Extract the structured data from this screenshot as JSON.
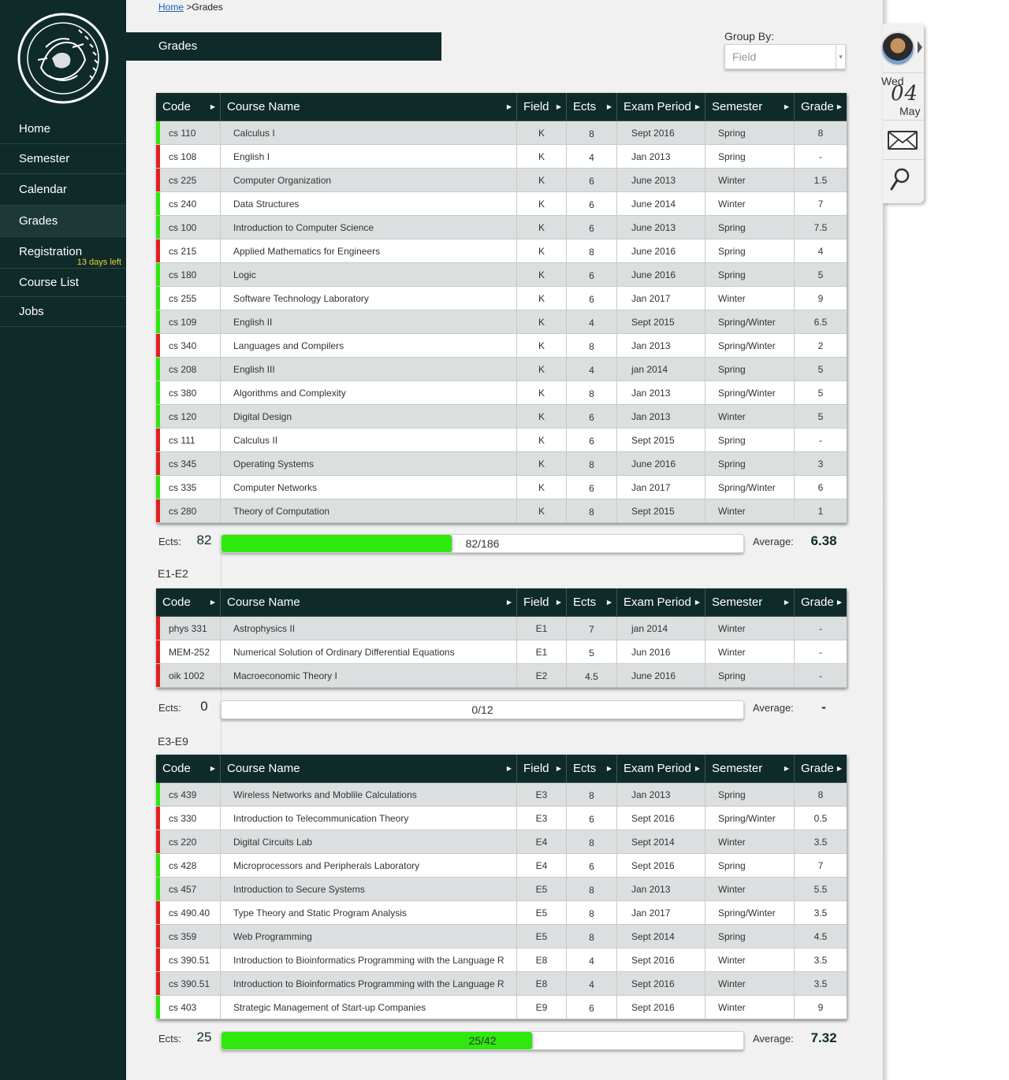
{
  "sidebar": {
    "items": [
      {
        "label": "Home",
        "badge": ""
      },
      {
        "label": "Semester",
        "badge": ""
      },
      {
        "label": "Calendar",
        "badge": ""
      },
      {
        "label": "Grades",
        "badge": ""
      },
      {
        "label": "Registration",
        "badge": "13 days left"
      },
      {
        "label": "Course List",
        "badge": ""
      },
      {
        "label": "Jobs",
        "badge": ""
      }
    ],
    "logo_text": "ΕΥΡΩΠΗ"
  },
  "breadcrumb": {
    "home": "Home",
    "separator": " >",
    "current": "Grades"
  },
  "page_title": "Grades",
  "group_by": {
    "label": "Group By:",
    "placeholder": "Field",
    "arrow": "▾"
  },
  "columns": [
    "Code",
    "Course Name",
    "Field",
    "Ects",
    "Exam Period",
    "Semester",
    "Grade"
  ],
  "colors": {
    "pass": "#2ee80e",
    "fail": "#e21f1f",
    "header_bg": "#0f2b29",
    "progress": "#2ee80e"
  },
  "groups": [
    {
      "title": "",
      "rows": [
        {
          "status": "pass",
          "code": "cs 110",
          "name": "Calculus I",
          "field": "K",
          "ects": "8",
          "exam": "Sept 2016",
          "semester": "Spring",
          "grade": "8"
        },
        {
          "status": "fail",
          "code": "cs 108",
          "name": "English I",
          "field": "K",
          "ects": "4",
          "exam": "Jan 2013",
          "semester": "Spring",
          "grade": "-"
        },
        {
          "status": "fail",
          "code": "cs 225",
          "name": "Computer Organization",
          "field": "K",
          "ects": "6",
          "exam": "June 2013",
          "semester": "Winter",
          "grade": "1.5"
        },
        {
          "status": "pass",
          "code": "cs 240",
          "name": "Data Structures",
          "field": "K",
          "ects": "6",
          "exam": "June 2014",
          "semester": "Winter",
          "grade": "7"
        },
        {
          "status": "pass",
          "code": "cs 100",
          "name": "Introduction to Computer Science",
          "field": "K",
          "ects": "6",
          "exam": "June 2013",
          "semester": "Spring",
          "grade": "7.5"
        },
        {
          "status": "fail",
          "code": "cs 215",
          "name": "Applied Mathematics for Engineers",
          "field": "K",
          "ects": "8",
          "exam": "June 2016",
          "semester": "Spring",
          "grade": "4"
        },
        {
          "status": "pass",
          "code": "cs 180",
          "name": "Logic",
          "field": "K",
          "ects": "6",
          "exam": "June 2016",
          "semester": "Spring",
          "grade": "5"
        },
        {
          "status": "pass",
          "code": "cs 255",
          "name": "Software Technology Laboratory",
          "field": "K",
          "ects": "6",
          "exam": "Jan 2017",
          "semester": "Winter",
          "grade": "9"
        },
        {
          "status": "pass",
          "code": "cs 109",
          "name": "English II",
          "field": "K",
          "ects": "4",
          "exam": "Sept 2015",
          "semester": "Spring/Winter",
          "grade": "6.5"
        },
        {
          "status": "fail",
          "code": "cs 340",
          "name": "Languages and Compilers",
          "field": "K",
          "ects": "8",
          "exam": "Jan 2013",
          "semester": "Spring/Winter",
          "grade": "2"
        },
        {
          "status": "pass",
          "code": "cs 208",
          "name": "English III",
          "field": "K",
          "ects": "4",
          "exam": "jan 2014",
          "semester": "Spring",
          "grade": "5"
        },
        {
          "status": "pass",
          "code": "cs 380",
          "name": "Algorithms and Complexity",
          "field": "K",
          "ects": "8",
          "exam": "Jan 2013",
          "semester": "Spring/Winter",
          "grade": "5"
        },
        {
          "status": "pass",
          "code": "cs 120",
          "name": "Digital Design",
          "field": "K",
          "ects": "6",
          "exam": "Jan 2013",
          "semester": "Winter",
          "grade": "5"
        },
        {
          "status": "fail",
          "code": "cs 111",
          "name": "Calculus II",
          "field": "K",
          "ects": "6",
          "exam": "Sept 2015",
          "semester": "Spring",
          "grade": "-"
        },
        {
          "status": "fail",
          "code": "cs 345",
          "name": "Operating Systems",
          "field": "K",
          "ects": "8",
          "exam": "June 2016",
          "semester": "Spring",
          "grade": "3"
        },
        {
          "status": "pass",
          "code": "cs 335",
          "name": "Computer Networks",
          "field": "K",
          "ects": "6",
          "exam": "Jan 2017",
          "semester": "Spring/Winter",
          "grade": "6"
        },
        {
          "status": "fail",
          "code": "cs 280",
          "name": "Theory of Computation",
          "field": "K",
          "ects": "8",
          "exam": "Sept 2015",
          "semester": "Winter",
          "grade": "1"
        }
      ],
      "summary": {
        "ects_label": "Ects:",
        "ects": "82",
        "progress_text": "82/186",
        "progress_fraction": 0.4409,
        "avg_label": "Average:",
        "avg": "6.38"
      }
    },
    {
      "title": "E1-E2",
      "rows": [
        {
          "status": "fail",
          "code": "phys 331",
          "name": "Astrophysics II",
          "field": "E1",
          "ects": "7",
          "exam": "jan 2014",
          "semester": "Winter",
          "grade": "-"
        },
        {
          "status": "fail",
          "code": "MEM-252",
          "name": "Numerical Solution of Ordinary Differential Equations",
          "field": "E1",
          "ects": "5",
          "exam": "Jun 2016",
          "semester": "Winter",
          "grade": "-"
        },
        {
          "status": "fail",
          "code": "oik 1002",
          "name": "Macroeconomic Theory I",
          "field": "E2",
          "ects": "4.5",
          "exam": "June 2016",
          "semester": "Spring",
          "grade": "-"
        }
      ],
      "summary": {
        "ects_label": "Ects:",
        "ects": "0",
        "progress_text": "0/12",
        "progress_fraction": 0.0,
        "avg_label": "Average:",
        "avg": "-"
      }
    },
    {
      "title": "E3-E9",
      "rows": [
        {
          "status": "pass",
          "code": "cs 439",
          "name": "Wireless Networks and Moblile Calculations",
          "field": "E3",
          "ects": "8",
          "exam": "Jan 2013",
          "semester": "Spring",
          "grade": "8"
        },
        {
          "status": "fail",
          "code": "cs 330",
          "name": "Introduction to Telecommunication Theory",
          "field": "E3",
          "ects": "6",
          "exam": "Sept 2016",
          "semester": "Spring/Winter",
          "grade": "0.5"
        },
        {
          "status": "fail",
          "code": "cs 220",
          "name": "Digital Circuits Lab",
          "field": "E4",
          "ects": "8",
          "exam": "Sept 2014",
          "semester": "Winter",
          "grade": "3.5"
        },
        {
          "status": "pass",
          "code": "cs 428",
          "name": "Microprocessors and Peripherals Laboratory",
          "field": "E4",
          "ects": "6",
          "exam": "Sept 2016",
          "semester": "Spring",
          "grade": "7"
        },
        {
          "status": "pass",
          "code": "cs 457",
          "name": "Introduction to Secure Systems",
          "field": "E5",
          "ects": "8",
          "exam": "Jan 2013",
          "semester": "Winter",
          "grade": "5.5"
        },
        {
          "status": "fail",
          "code": "cs 490.40",
          "name": "Type Theory and Static Program Analysis",
          "field": "E5",
          "ects": "8",
          "exam": "Jan 2017",
          "semester": "Spring/Winter",
          "grade": "3.5"
        },
        {
          "status": "fail",
          "code": "cs 359",
          "name": "Web Programming",
          "field": "E5",
          "ects": "8",
          "exam": "Sept 2014",
          "semester": "Spring",
          "grade": "4.5"
        },
        {
          "status": "fail",
          "code": "cs 390.51",
          "name": "Introduction to Bioinformatics Programming with the Language R",
          "field": "E8",
          "ects": "4",
          "exam": "Sept 2016",
          "semester": "Winter",
          "grade": "3.5"
        },
        {
          "status": "fail",
          "code": "cs 390.51",
          "name": "Introduction to Bioinformatics Programming with the Language R",
          "field": "E8",
          "ects": "4",
          "exam": "Sept 2016",
          "semester": "Winter",
          "grade": "3.5"
        },
        {
          "status": "pass",
          "code": "cs 403",
          "name": "Strategic Management of Start-up Companies",
          "field": "E9",
          "ects": "6",
          "exam": "Sept 2016",
          "semester": "Winter",
          "grade": "9"
        }
      ],
      "summary": {
        "ects_label": "Ects:",
        "ects": "25",
        "progress_text": "25/42",
        "progress_fraction": 0.5952,
        "avg_label": "Average:",
        "avg": "7.32"
      }
    }
  ],
  "widget": {
    "day": "Wed",
    "date": "04",
    "month": "May",
    "avatar_icon": "avatar",
    "mail_icon": "mail-icon",
    "search_icon": "search-icon"
  }
}
